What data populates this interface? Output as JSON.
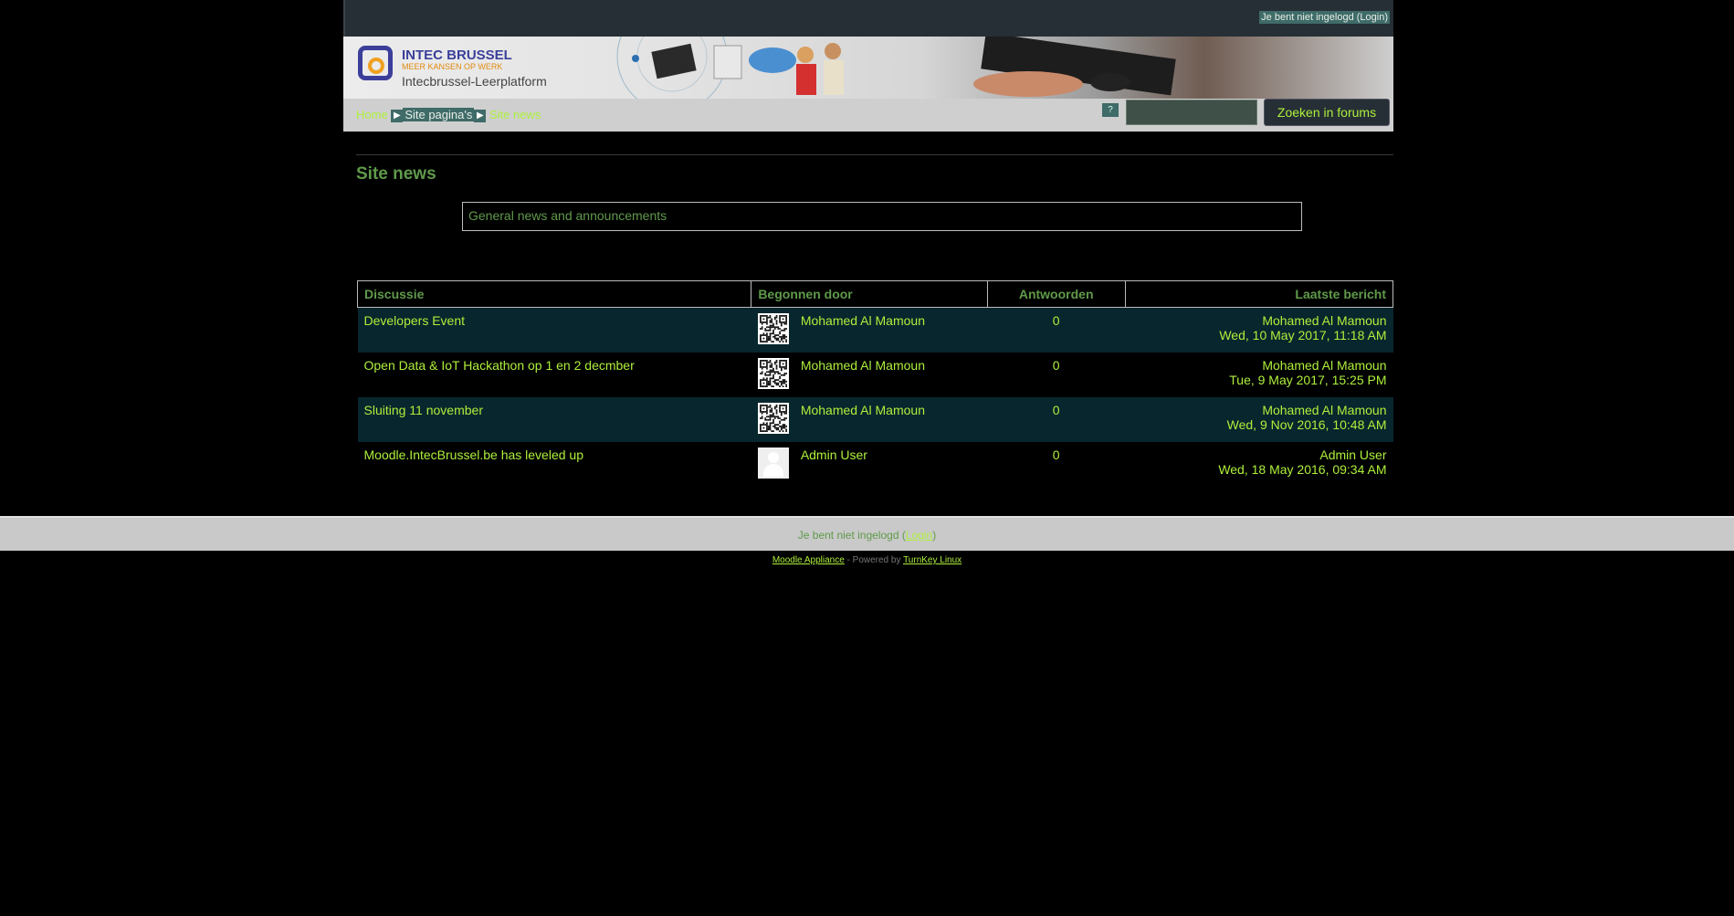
{
  "header": {
    "login_info": "Je bent niet ingelogd (Login)"
  },
  "banner": {
    "logo_title": "INTEC BRUSSEL",
    "logo_subtitle": "MEER KANSEN OP WERK",
    "platform_name": "Intecbrussel-Leerplatform"
  },
  "breadcrumb": {
    "items": [
      "Home",
      "Site pagina's",
      "Site news"
    ]
  },
  "search": {
    "value": "",
    "button_label": "Zoeken in forums"
  },
  "forum": {
    "title": "Site news",
    "description": "General news and announcements",
    "columns": [
      "Discussie",
      "Begonnen door",
      "Antwoorden",
      "Laatste bericht"
    ],
    "discussions": [
      {
        "title": "Developers Event",
        "started_by": "Mohamed Al Mamoun",
        "avatar": "qr-code-avatar",
        "replies": "0",
        "last_author": "Mohamed Al Mamoun",
        "last_date": "Wed, 10 May 2017, 11:18 AM"
      },
      {
        "title": "Open Data & IoT Hackathon op 1 en 2 decmber",
        "started_by": "Mohamed Al Mamoun",
        "avatar": "qr-code-avatar",
        "replies": "0",
        "last_author": "Mohamed Al Mamoun",
        "last_date": "Tue, 9 May 2017, 15:25 PM"
      },
      {
        "title": "Sluiting 11 november",
        "started_by": "Mohamed Al Mamoun",
        "avatar": "qr-code-avatar",
        "replies": "0",
        "last_author": "Mohamed Al Mamoun",
        "last_date": "Wed, 9 Nov 2016, 10:48 AM"
      },
      {
        "title": "Moodle.IntecBrussel.be has leveled up",
        "started_by": "Admin User",
        "avatar": "default-user-avatar",
        "replies": "0",
        "last_author": "Admin User",
        "last_date": "Wed, 18 May 2016, 09:34 AM"
      }
    ]
  },
  "footer": {
    "login_prefix": "Je bent niet ingelogd (",
    "login_link": "Login",
    "login_suffix": ")",
    "appliance": "Moodle Appliance",
    "powered_by": " - Powered by ",
    "turnkey": "TurnKey Linux"
  },
  "colors": {
    "link": "#aef03c",
    "heading": "#5f9a4a",
    "row_alt": "#08262d",
    "accent": "#3f6b68"
  }
}
